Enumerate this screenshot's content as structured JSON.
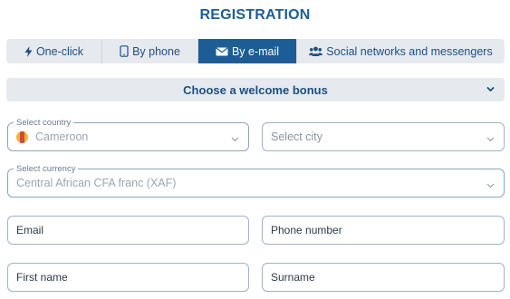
{
  "header": {
    "title": "REGISTRATION"
  },
  "tabs": [
    {
      "label": "One-click",
      "icon": "lightning-icon",
      "active": false
    },
    {
      "label": "By phone",
      "icon": "phone-icon",
      "active": false
    },
    {
      "label": "By e-mail",
      "icon": "envelope-icon",
      "active": true
    },
    {
      "label": "Social networks and messengers",
      "icon": "users-icon",
      "active": false
    }
  ],
  "bonus": {
    "label": "Choose a welcome bonus"
  },
  "form": {
    "country": {
      "label": "Select country",
      "value": "Cameroon"
    },
    "city": {
      "placeholder": "Select city"
    },
    "currency": {
      "label": "Select currency",
      "value": "Central African CFA franc (XAF)"
    },
    "email": {
      "placeholder": "Email"
    },
    "phone": {
      "placeholder": "Phone number"
    },
    "first_name": {
      "placeholder": "First name"
    },
    "surname": {
      "placeholder": "Surname"
    }
  },
  "colors": {
    "accent": "#1d5d96",
    "tab_background": "#e6eaef",
    "border": "#9fb3c8"
  }
}
